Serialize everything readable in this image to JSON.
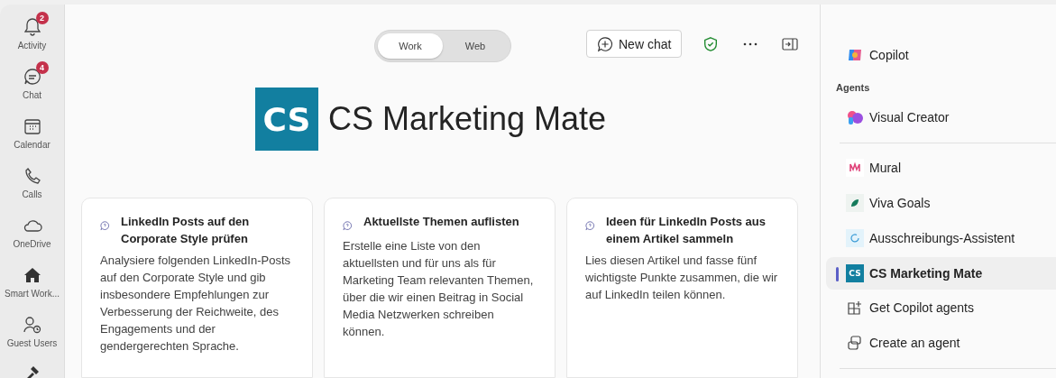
{
  "rail": [
    {
      "label": "Activity",
      "badge": "2"
    },
    {
      "label": "Chat",
      "badge": "4"
    },
    {
      "label": "Calendar"
    },
    {
      "label": "Calls"
    },
    {
      "label": "OneDrive"
    },
    {
      "label": "Smart Work..."
    },
    {
      "label": "Guest Users"
    }
  ],
  "mode_toggle": [
    {
      "label": "Work",
      "selected": true
    },
    {
      "label": "Web",
      "selected": false
    }
  ],
  "toolbar": {
    "new_chat": "New chat"
  },
  "agent_header": {
    "logo": "CS",
    "title": "CS Marketing Mate"
  },
  "prompt_cards": [
    {
      "title": "LinkedIn Posts auf den Corporate Style prüfen",
      "body": "Analysiere folgenden LinkedIn-Posts auf den Corporate Style und gib insbesondere Empfehlungen zur Verbesserung der Reichweite, des Engagements und der gendergerechten Sprache."
    },
    {
      "title": "Aktuellste Themen auflisten",
      "body": "Erstelle eine Liste von den aktuellsten und für uns als für Marketing Team relevanten Themen, über die wir einen Beitrag in Social Media Netzwerken schreiben können."
    },
    {
      "title": "Ideen für LinkedIn Posts aus einem Artikel sammeln",
      "body": "Lies diesen Artikel und fasse fünf wichtigste Punkte zusammen, die wir auf LinkedIn teilen können."
    }
  ],
  "side_panel": {
    "copilot": "Copilot",
    "agents_heading": "Agents",
    "featured": [
      {
        "label": "Visual Creator",
        "selected": false
      }
    ],
    "agents": [
      {
        "label": "Mural",
        "selected": false
      },
      {
        "label": "Viva Goals",
        "selected": false
      },
      {
        "label": "Ausschreibungs-Assistent",
        "selected": false
      },
      {
        "label": "CS Marketing Mate",
        "selected": true,
        "logo": "CS"
      }
    ],
    "actions": [
      {
        "label": "Get Copilot agents"
      },
      {
        "label": "Create an agent"
      }
    ]
  }
}
